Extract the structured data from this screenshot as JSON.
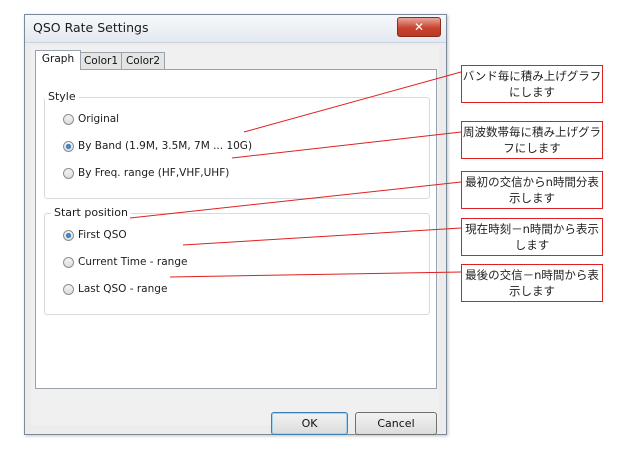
{
  "dialog": {
    "title": "QSO Rate Settings",
    "close_label": "✕",
    "tabs": [
      {
        "label": "Graph",
        "active": true
      },
      {
        "label": "Color1",
        "active": false
      },
      {
        "label": "Color2",
        "active": false
      }
    ],
    "style": {
      "label": "Style",
      "options": [
        {
          "label": "Original",
          "checked": false
        },
        {
          "label": "By Band (1.9M, 3.5M, 7M ... 10G)",
          "checked": true
        },
        {
          "label": "By Freq. range (HF,VHF,UHF)",
          "checked": false
        }
      ]
    },
    "start_position": {
      "label": "Start position",
      "options": [
        {
          "label": "First QSO",
          "checked": true
        },
        {
          "label": "Current Time - range",
          "checked": false
        },
        {
          "label": "Last QSO - range",
          "checked": false
        }
      ]
    },
    "ok_label": "OK",
    "cancel_label": "Cancel"
  },
  "callouts": [
    {
      "text": "バンド毎に積み上げグラフにします"
    },
    {
      "text": "周波数帯毎に積み上げグラフにします"
    },
    {
      "text": "最初の交信からn時間分表示します"
    },
    {
      "text": "現在時刻－n時間から表示します"
    },
    {
      "text": "最後の交信－n時間から表示します"
    }
  ],
  "colors": {
    "callout_border": "#e02020",
    "annotation_line": "#e02020"
  }
}
